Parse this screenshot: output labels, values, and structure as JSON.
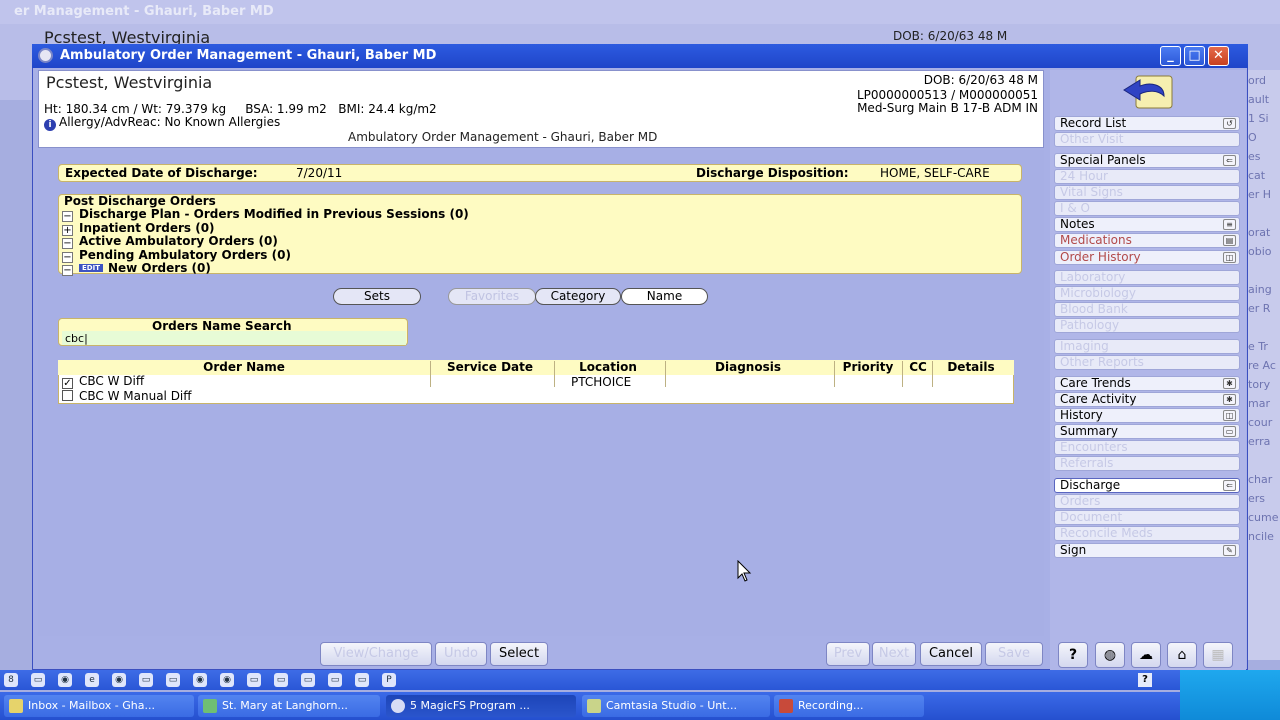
{
  "background_window": {
    "title": "er Management - Ghauri, Baber MD",
    "patient_name": "Pcstest, Westvirginia",
    "dob": "DOB: 6/20/63 48 M"
  },
  "window": {
    "title": "Ambulatory Order Management - Ghauri, Baber MD",
    "minimize": "_",
    "maximize": "□",
    "close": "✕"
  },
  "patient": {
    "name": "Pcstest, Westvirginia",
    "vitals": "Ht: 180.34 cm / Wt: 79.379 kg     BSA: 1.99 m2   BMI: 24.4 kg/m2",
    "allergy": "Allergy/AdvReac: No Known Allergies",
    "context": "Ambulatory Order Management - Ghauri, Baber MD",
    "dob": "DOB: 6/20/63 48 M",
    "ids": "LP0000000513 / M000000051",
    "location": "Med-Surg Main B 17-B  ADM IN"
  },
  "discharge": {
    "expected_label": "Expected Date of Discharge:",
    "expected_value": "7/20/11",
    "disposition_label": "Discharge Disposition:",
    "disposition_value": "HOME, SELF-CARE"
  },
  "post_discharge": {
    "title": "Post Discharge Orders",
    "rows": [
      {
        "toggle": "−",
        "label": "Discharge Plan - Orders Modified in Previous Sessions (0)"
      },
      {
        "toggle": "+",
        "label": "Inpatient Orders (0)"
      },
      {
        "toggle": "−",
        "label": "Active Ambulatory Orders (0)"
      },
      {
        "toggle": "−",
        "label": "Pending Ambulatory Orders (0)"
      },
      {
        "toggle": "−",
        "label": "New Orders (0)",
        "badge": "EDIT"
      }
    ]
  },
  "filter_tabs": {
    "sets": "Sets",
    "favorites": "Favorites",
    "category": "Category",
    "name": "Name"
  },
  "search": {
    "label": "Orders Name Search",
    "value": "cbc|"
  },
  "orders_table": {
    "headers": [
      "Order Name",
      "Service Date",
      "Location",
      "Diagnosis",
      "Priority",
      "CC",
      "Details"
    ],
    "rows": [
      {
        "checked": "✓",
        "name": "CBC W Diff",
        "location": "PTCHOICE"
      },
      {
        "checked": "",
        "name": "CBC W Manual Diff",
        "location": ""
      }
    ]
  },
  "sidebar": {
    "items": [
      {
        "label": "Record List",
        "state": "normal",
        "icon": "↺"
      },
      {
        "label": "Other Visit",
        "state": "disabled",
        "icon": ""
      },
      {
        "label": "Special Panels",
        "state": "normal",
        "icon": "⇐"
      },
      {
        "label": "24 Hour",
        "state": "disabled",
        "icon": ""
      },
      {
        "label": "Vital Signs",
        "state": "disabled",
        "icon": ""
      },
      {
        "label": "I & O",
        "state": "disabled",
        "icon": ""
      },
      {
        "label": "Notes",
        "state": "normal",
        "icon": "≡"
      },
      {
        "label": "Medications",
        "state": "red",
        "icon": "▤"
      },
      {
        "label": "Order History",
        "state": "red",
        "icon": "◫"
      },
      {
        "label": "Laboratory",
        "state": "disabled",
        "icon": ""
      },
      {
        "label": "Microbiology",
        "state": "disabled",
        "icon": ""
      },
      {
        "label": "Blood Bank",
        "state": "disabled",
        "icon": ""
      },
      {
        "label": "Pathology",
        "state": "disabled",
        "icon": ""
      },
      {
        "label": "Imaging",
        "state": "disabled",
        "icon": ""
      },
      {
        "label": "Other Reports",
        "state": "disabled",
        "icon": ""
      },
      {
        "label": "Care Trends",
        "state": "normal",
        "icon": "✱"
      },
      {
        "label": "Care Activity",
        "state": "normal",
        "icon": "✱"
      },
      {
        "label": "History",
        "state": "normal",
        "icon": "◫"
      },
      {
        "label": "Summary",
        "state": "normal",
        "icon": "▭"
      },
      {
        "label": "Encounters",
        "state": "disabled",
        "icon": ""
      },
      {
        "label": "Referrals",
        "state": "disabled",
        "icon": ""
      },
      {
        "label": "Discharge",
        "state": "selected",
        "icon": "⇐"
      },
      {
        "label": "Orders",
        "state": "disabled",
        "icon": ""
      },
      {
        "label": "Document",
        "state": "disabled",
        "icon": ""
      },
      {
        "label": "Reconcile Meds",
        "state": "disabled",
        "icon": ""
      },
      {
        "label": "Sign",
        "state": "normal",
        "icon": "✎"
      }
    ]
  },
  "bottom_buttons": {
    "view_change": "View/Change",
    "undo": "Undo",
    "select": "Select",
    "prev": "Prev",
    "next": "Next",
    "cancel": "Cancel",
    "save": "Save"
  },
  "quicklaunch": [
    "8",
    "▭",
    "◉",
    "e",
    "◉",
    "▭",
    "▭",
    "◉",
    "◉",
    "▭",
    "▭",
    "▭",
    "▭",
    "▭",
    "P"
  ],
  "taskbar": [
    {
      "label": "Inbox - Mailbox - Gha..."
    },
    {
      "label": "St. Mary at Langhorn..."
    },
    {
      "label": "5 MagicFS Program ..."
    },
    {
      "label": "Camtasia Studio - Unt..."
    },
    {
      "label": "Recording..."
    }
  ],
  "tray": {
    "help": "?"
  },
  "background_right": [
    "ord",
    "ault",
    "1 Si",
    "O",
    "es",
    "cat",
    "er H",
    "",
    "orat",
    "obio",
    "",
    "aing",
    "er R",
    "",
    "e Tr",
    "re Ac",
    "tory",
    "mar",
    "cour",
    "erra",
    "",
    "char",
    "ers",
    "cume",
    "ncile",
    "",
    "",
    "",
    ""
  ]
}
